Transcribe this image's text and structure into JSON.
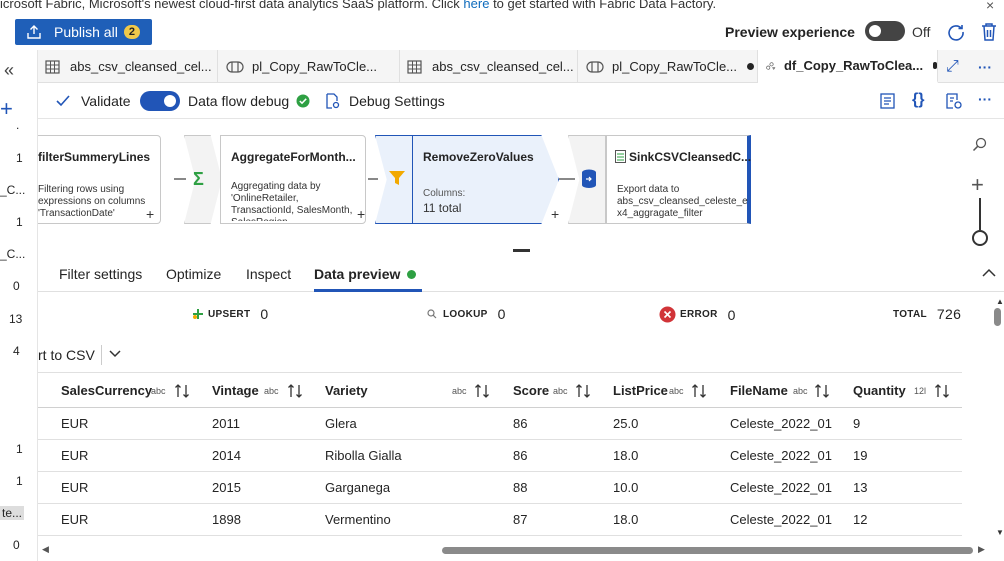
{
  "banner": {
    "text_before": "icrosoft Fabric, Microsoft's newest cloud-first data analytics SaaS platform. Click ",
    "link": "here",
    "text_after": " to get started with Fabric Data Factory.",
    "close": "×"
  },
  "topbar": {
    "publish_label": "Publish all",
    "publish_count": "2",
    "preview_label": "Preview experience",
    "preview_state": "Off"
  },
  "leftrail": {
    "collapse": "«",
    "add": "+",
    "items": [
      ".",
      "1",
      "_C...",
      "1",
      "_C...",
      "0",
      "13",
      "4",
      "1",
      "1",
      "te...",
      "0"
    ]
  },
  "tabs": [
    {
      "label": "abs_csv_cleansed_cel...",
      "icon": "dataset-icon"
    },
    {
      "label": "pl_Copy_RawToCle...",
      "icon": "pipeline-icon"
    },
    {
      "label": "abs_csv_cleansed_cel...",
      "icon": "dataset-icon"
    },
    {
      "label": "pl_Copy_RawToCle...",
      "icon": "pipeline-icon"
    },
    {
      "label": "df_Copy_RawToClea...",
      "icon": "dataflow-icon"
    }
  ],
  "tab_actions": {
    "expand": "⤢",
    "more": "···"
  },
  "toolbar": {
    "validate": "Validate",
    "debug": "Data flow debug",
    "debug_settings": "Debug Settings",
    "more": "···"
  },
  "nodes": {
    "filter": {
      "title": "filterSummeryLines",
      "desc": "Filtering rows using expressions on columns 'TransactionDate'"
    },
    "aggregate": {
      "title": "AggregateForMonth...",
      "desc": "Aggregating data by 'OnlineRetailer, TransactionId, SalesMonth, SalesRegion,"
    },
    "remove": {
      "title": "RemoveZeroValues",
      "columns_label": "Columns:",
      "columns_value": "11 total"
    },
    "sink": {
      "title": "SinkCSVCleansedC...",
      "desc": "Export data to abs_csv_cleansed_celeste_e x4_aggragate_filter"
    },
    "plus": "+"
  },
  "bottom_tabs": {
    "filter_settings": "Filter settings",
    "optimize": "Optimize",
    "inspect": "Inspect",
    "data_preview": "Data preview"
  },
  "stats": {
    "upsert_label": "UPSERT",
    "upsert_value": "0",
    "lookup_label": "LOOKUP",
    "lookup_value": "0",
    "error_label": "ERROR",
    "error_value": "0",
    "total_label": "TOTAL",
    "total_value": "726"
  },
  "export_dropdown": "rt to CSV",
  "grid": {
    "columns": [
      {
        "name": "SalesCurrency",
        "type": "abc"
      },
      {
        "name": "Vintage",
        "type": "abc"
      },
      {
        "name": "Variety",
        "type": "abc"
      },
      {
        "name": "Score",
        "type": "abc"
      },
      {
        "name": "ListPrice",
        "type": "abc"
      },
      {
        "name": "FileName",
        "type": "abc"
      },
      {
        "name": "Quantity",
        "type": "12l"
      }
    ],
    "rows": [
      [
        "EUR",
        "2011",
        "Glera",
        "86",
        "25.0",
        "Celeste_2022_01",
        "9"
      ],
      [
        "EUR",
        "2014",
        "Ribolla Gialla",
        "86",
        "18.0",
        "Celeste_2022_01",
        "19"
      ],
      [
        "EUR",
        "2015",
        "Garganega",
        "88",
        "10.0",
        "Celeste_2022_01",
        "13"
      ],
      [
        "EUR",
        "1898",
        "Vermentino",
        "87",
        "18.0",
        "Celeste_2022_01",
        "12"
      ]
    ]
  },
  "colors": {
    "accent": "#2155b7",
    "publish": "#1f5fb8",
    "success": "#2ea043",
    "error": "#d13438"
  }
}
